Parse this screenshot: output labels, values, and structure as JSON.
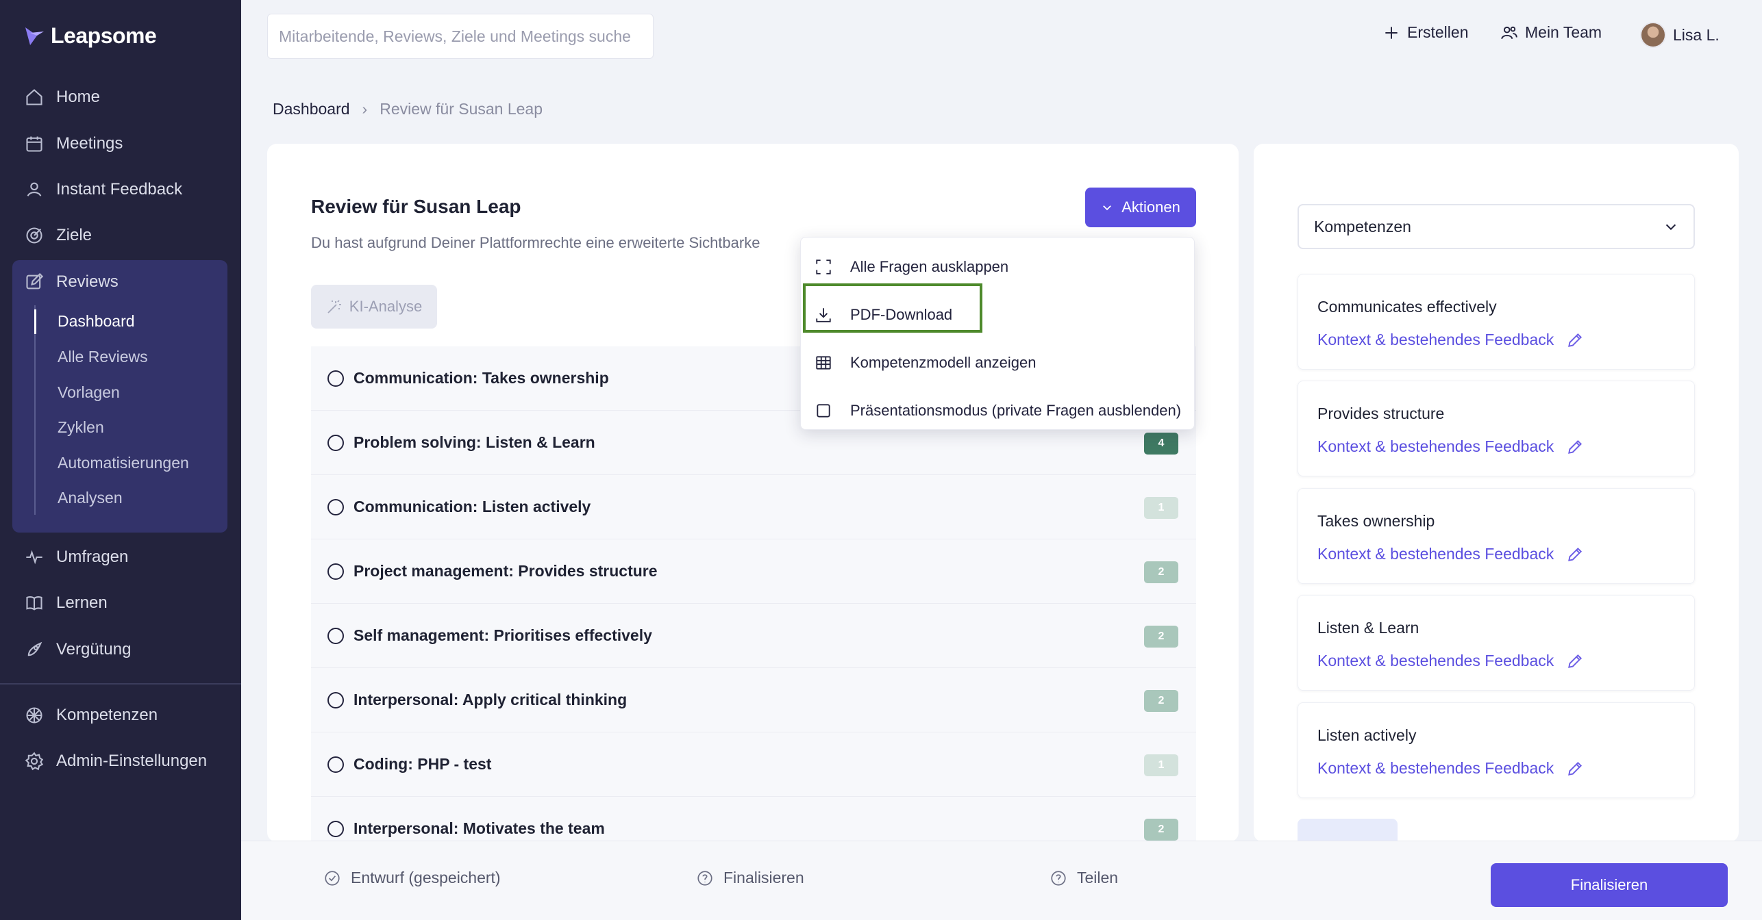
{
  "brand": {
    "name": "Leapsome",
    "accent": "#5b4fe0"
  },
  "sidebar": {
    "items": [
      {
        "label": "Home",
        "icon": "home-icon"
      },
      {
        "label": "Meetings",
        "icon": "calendar-icon"
      },
      {
        "label": "Instant Feedback",
        "icon": "feedback-icon"
      },
      {
        "label": "Ziele",
        "icon": "target-icon"
      },
      {
        "label": "Reviews",
        "icon": "edit-icon"
      }
    ],
    "reviews_sub": [
      "Dashboard",
      "Alle Reviews",
      "Vorlagen",
      "Zyklen",
      "Automatisierungen",
      "Analysen"
    ],
    "items_lower": [
      {
        "label": "Umfragen",
        "icon": "pulse-icon"
      },
      {
        "label": "Lernen",
        "icon": "book-icon"
      },
      {
        "label": "Vergütung",
        "icon": "rocket-icon"
      }
    ],
    "items_bottom": [
      {
        "label": "Kompetenzen",
        "icon": "competency-icon"
      },
      {
        "label": "Admin-Einstellungen",
        "icon": "gear-icon"
      }
    ]
  },
  "topbar": {
    "search_placeholder": "Mitarbeitende, Reviews, Ziele und Meetings suche",
    "create_label": "Erstellen",
    "team_label": "Mein Team",
    "user_name": "Lisa L."
  },
  "breadcrumb": {
    "root": "Dashboard",
    "separator": "›",
    "current": "Review für Susan Leap"
  },
  "review": {
    "title": "Review für Susan Leap",
    "subtitle": "Du hast aufgrund Deiner Plattformrechte eine erweiterte Sichtbarke",
    "ki_label": "KI-Analyse",
    "actions_label": "Aktionen",
    "questions": [
      {
        "label": "Communication: Takes ownership",
        "badge": ""
      },
      {
        "label": "Problem solving: Listen & Learn",
        "badge": "4",
        "color": "#3f7a63"
      },
      {
        "label": "Communication: Listen actively",
        "badge": "1",
        "color": "#d3e2dc"
      },
      {
        "label": "Project management: Provides structure",
        "badge": "2",
        "color": "#a9c7bb"
      },
      {
        "label": "Self management: Prioritises effectively",
        "badge": "2",
        "color": "#a9c7bb"
      },
      {
        "label": "Interpersonal: Apply critical thinking",
        "badge": "2",
        "color": "#a9c7bb"
      },
      {
        "label": "Coding: PHP - test",
        "badge": "1",
        "color": "#d3e2dc"
      },
      {
        "label": "Interpersonal: Motivates the team",
        "badge": "2",
        "color": "#a9c7bb"
      }
    ]
  },
  "actions_menu": [
    {
      "label": "Alle Fragen ausklappen",
      "icon": "expand-icon"
    },
    {
      "label": "PDF-Download",
      "icon": "download-icon"
    },
    {
      "label": "Kompetenzmodell anzeigen",
      "icon": "table-icon"
    },
    {
      "label": "Präsentationsmodus (private Fragen ausblenden)",
      "icon": "checkbox-icon"
    }
  ],
  "right_panel": {
    "select_value": "Kompetenzen",
    "link_label": "Kontext & bestehendes Feedback",
    "competencies": [
      "Communicates effectively",
      "Provides structure",
      "Takes ownership",
      "Listen & Learn",
      "Listen actively"
    ]
  },
  "bottombar": {
    "draft": "Entwurf (gespeichert)",
    "finalize_step": "Finalisieren",
    "share_step": "Teilen",
    "finalize_button": "Finalisieren"
  }
}
